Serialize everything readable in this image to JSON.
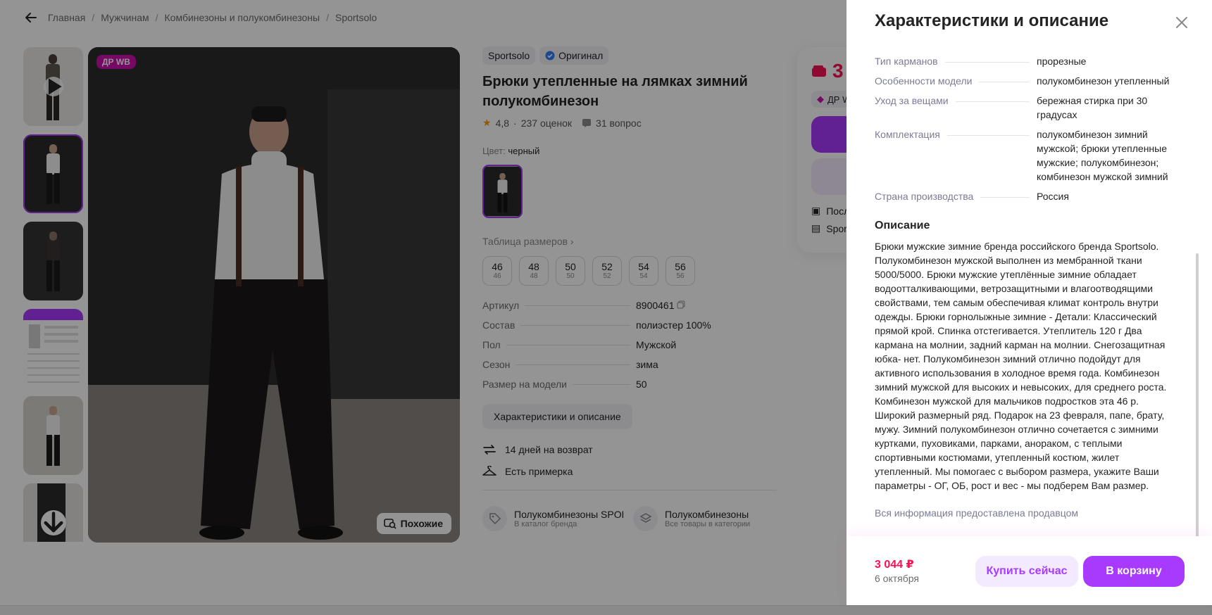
{
  "breadcrumb": {
    "items": [
      "Главная",
      "Мужчинам",
      "Комбинезоны и полукомбинезоны",
      "Sportsolo"
    ]
  },
  "gallery": {
    "badge": "ДР WB",
    "similar_label": "Похожие"
  },
  "product": {
    "brand": "Sportsolo",
    "original_label": "Оригинал",
    "title": "Брюки утепленные на лямках зимний полукомбинезон",
    "rating": "4,8",
    "reviews": "237 оценок",
    "questions": "31 вопрос",
    "color_label": "Цвет:",
    "color_value": "черный",
    "size_table_label": "Таблица размеров",
    "sizes": [
      {
        "main": "46",
        "sub": "46"
      },
      {
        "main": "48",
        "sub": "48"
      },
      {
        "main": "50",
        "sub": "50"
      },
      {
        "main": "52",
        "sub": "52"
      },
      {
        "main": "54",
        "sub": "54"
      },
      {
        "main": "56",
        "sub": "56"
      }
    ],
    "params": [
      {
        "key": "Артикул",
        "value": "8900461"
      },
      {
        "key": "Состав",
        "value": "полиэстер 100%"
      },
      {
        "key": "Пол",
        "value": "Мужской"
      },
      {
        "key": "Сезон",
        "value": "зима"
      },
      {
        "key": "Размер на модели",
        "value": "50"
      }
    ],
    "char_button": "Характеристики и описание",
    "return_label": "14 дней на возврат",
    "fitting_label": "Есть примерка",
    "categories": [
      {
        "title": "Полукомбинезоны SPORTSOLO",
        "sub": "В каталог бренда"
      },
      {
        "title": "Полукомбинезоны",
        "sub": "Все товары в категории"
      }
    ]
  },
  "buy_card": {
    "price_partial": "3",
    "dr_partial": "ДР W",
    "line1": "Посл",
    "line2": "Spor"
  },
  "drawer": {
    "title": "Характеристики и описание",
    "characteristics": [
      {
        "key": "Тип карманов",
        "value": "прорезные"
      },
      {
        "key": "Особенности модели",
        "value": "полукомбинезон утепленный"
      },
      {
        "key": "Уход за вещами",
        "value": "бережная стирка при 30 градусах"
      },
      {
        "key": "Комплектация",
        "value": "полукомбинезон зимний мужской; брюки утепленные мужские; полукомбинезон; комбинезон мужской зимний"
      },
      {
        "key": "Страна производства",
        "value": "Россия"
      }
    ],
    "description_title": "Описание",
    "description": "Брюки мужские зимние бренда российского бренда Sportsolo. Полукомбинезон мужской выполнен из мембранной ткани 5000/5000. Брюки мужские утеплённые зимние обладает водоотталкивающими, ветрозащитными и влагоотводящими свойствами, тем самым обеспечивая климат контроль внутри одежды. Брюки горнолыжные зимние - Детали: Классический прямой крой. Спинка отстегивается. Утеплитель 120 г Два кармана на молнии, задний карман на молнии. Снегозащитная юбка- нет. Полукомбинезон зимний отлично подойдут для активного использования в холодное время года. Комбинезон зимний мужской для высоких и невысоких, для среднего роста. Комбинезон мужской для мальчиков подростков эта 46 р. Широкий размерный ряд. Подарок на 23 февраля, папе, брату, мужу. Зимний полукомбинезон отлично сочетается с зимними куртками, пуховиками, парками, анораком, с теплыми спортивными костюмами, утепленный костюм, жилет утепленный. Мы помогаес с выбором размера, укажите Ваши параметры - ОГ, ОБ, рост и вес - мы подберем Вам размер.",
    "seller_note": "Вся информация предоставлена продавцом",
    "footer": {
      "price": "3 044 ₽",
      "date": "6 октября",
      "buy_now": "Купить сейчас",
      "add_to_cart": "В корзину"
    }
  },
  "colors": {
    "accent": "#a73afd",
    "price": "#f91155",
    "badge": "#cb11ab",
    "star": "#ff9900"
  }
}
